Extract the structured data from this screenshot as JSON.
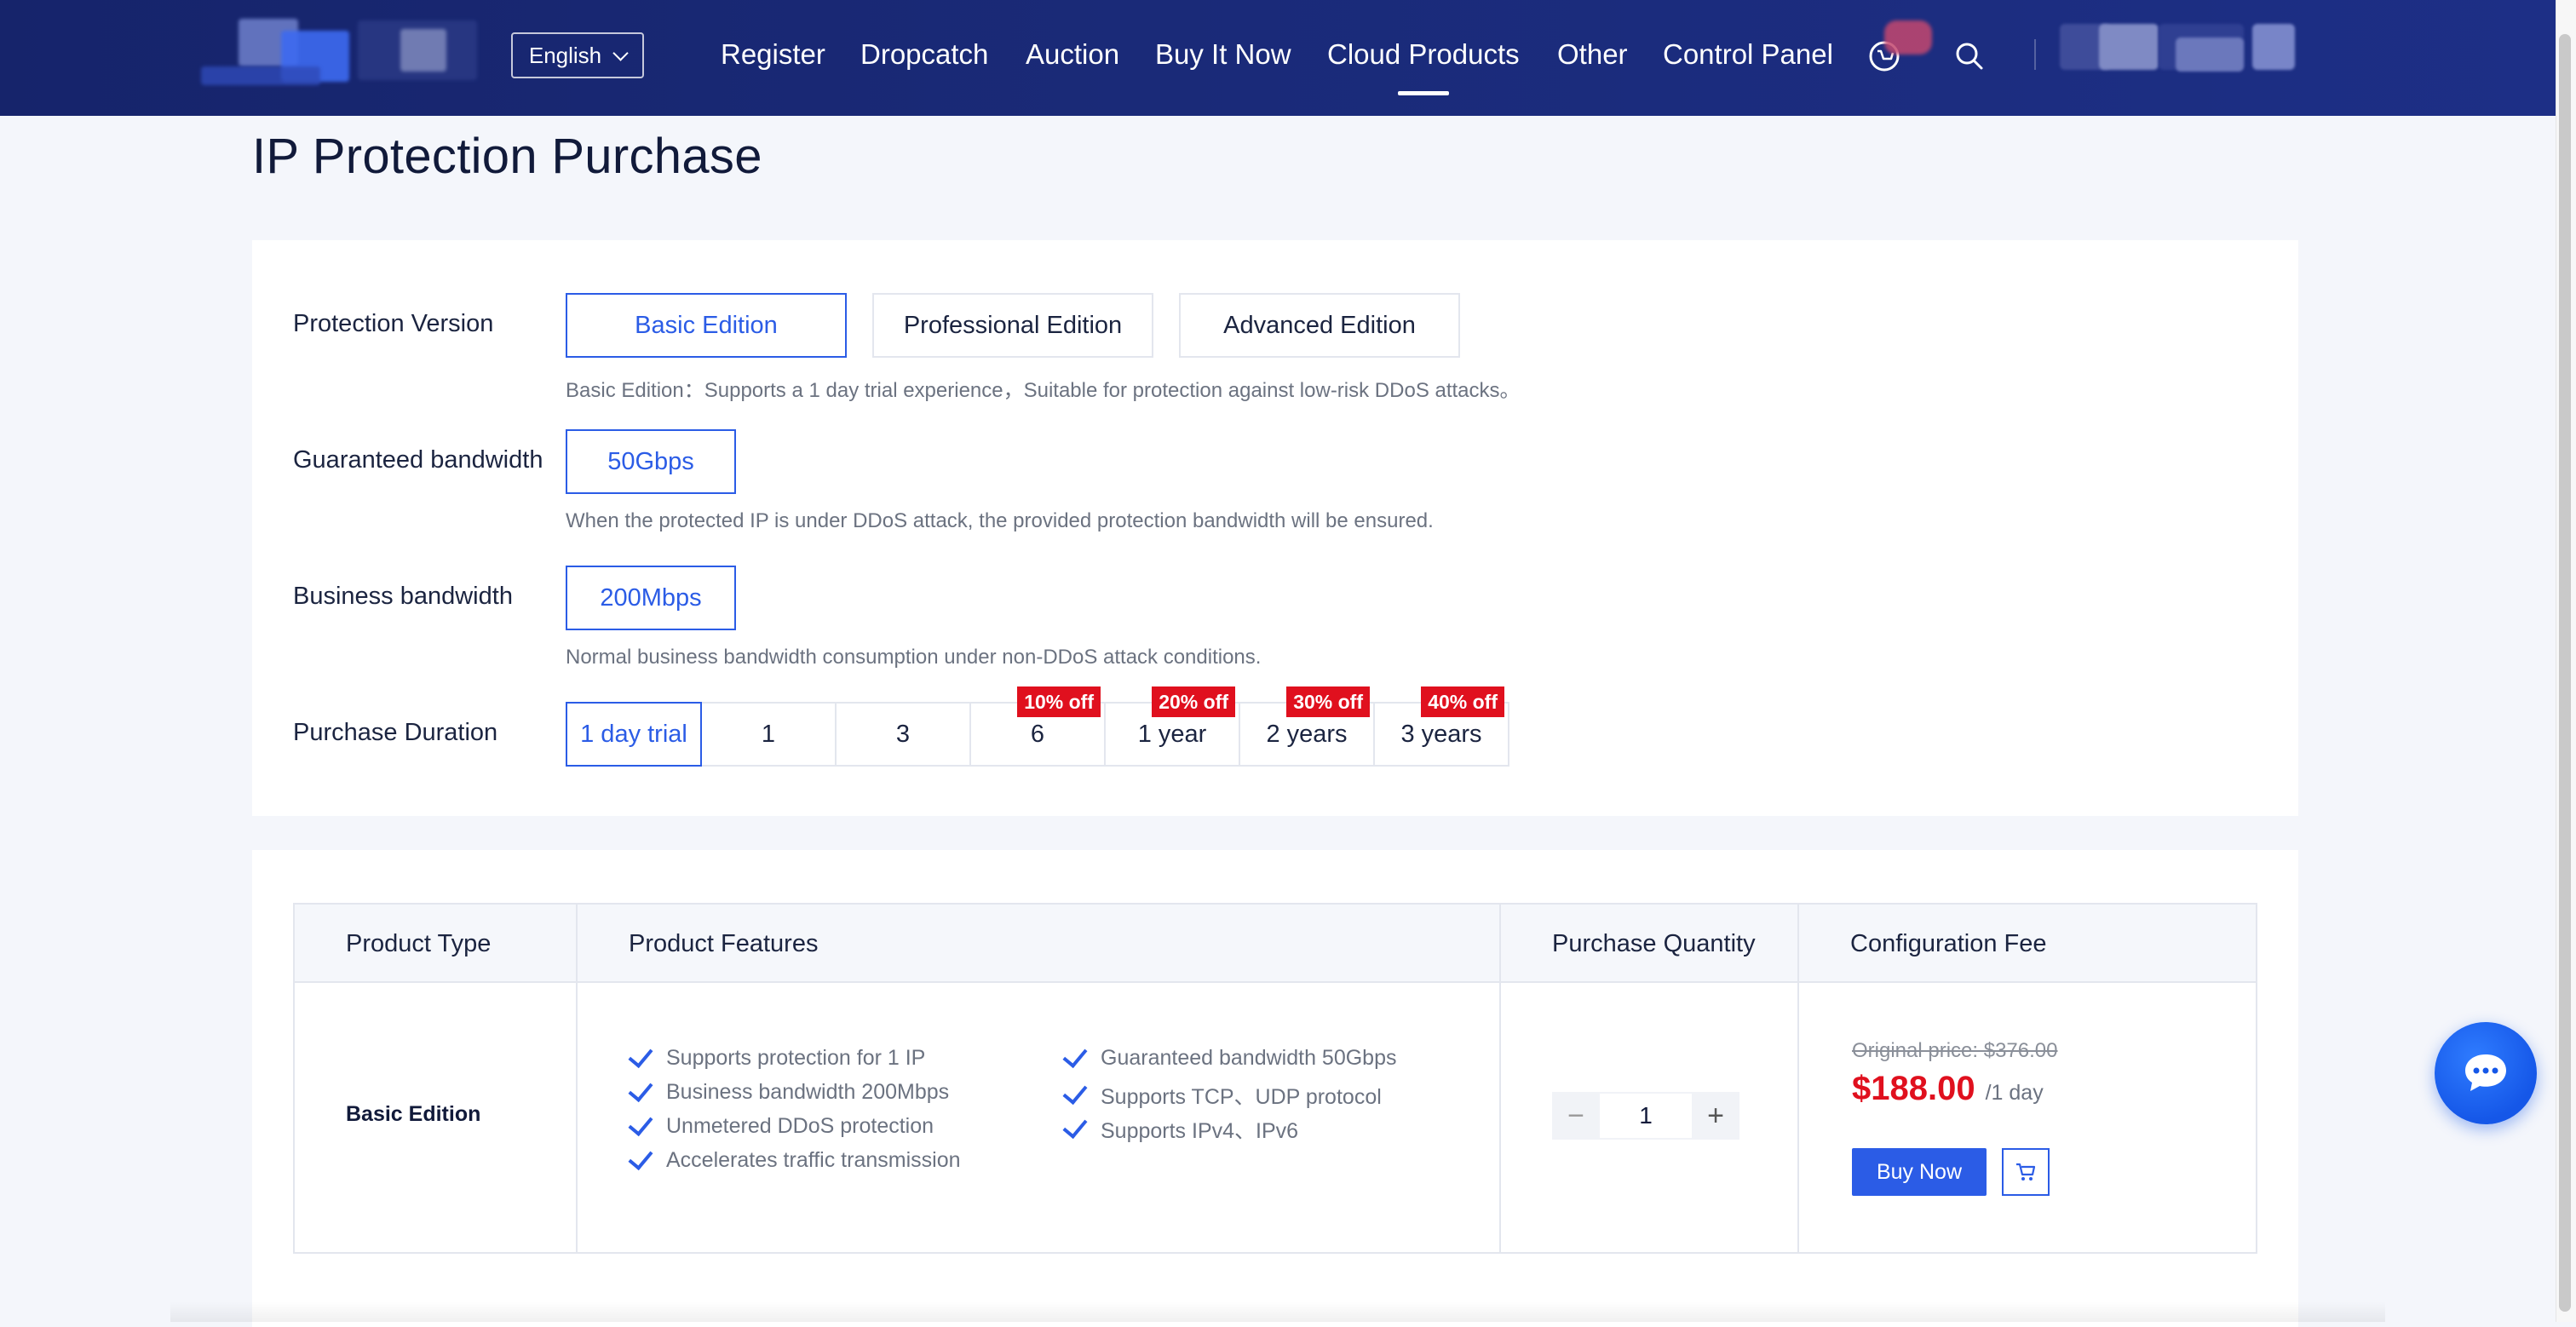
{
  "header": {
    "language": "English",
    "nav": [
      {
        "label": "Register"
      },
      {
        "label": "Dropcatch"
      },
      {
        "label": "Auction"
      },
      {
        "label": "Buy It Now"
      },
      {
        "label": "Cloud Products",
        "active": true
      },
      {
        "label": "Other"
      },
      {
        "label": "Control Panel"
      }
    ],
    "icons": [
      "cart-icon",
      "search-icon"
    ]
  },
  "page": {
    "title": "IP Protection Purchase"
  },
  "config": {
    "protection_version": {
      "label": "Protection Version",
      "options": [
        "Basic Edition",
        "Professional Edition",
        "Advanced Edition"
      ],
      "selected": "Basic Edition",
      "hint": "Basic Edition：Supports a 1 day trial experience，Suitable for protection against low-risk DDoS attacks。"
    },
    "guaranteed_bandwidth": {
      "label": "Guaranteed bandwidth",
      "options": [
        "50Gbps"
      ],
      "selected": "50Gbps",
      "hint": "When the protected IP is under DDoS attack, the provided protection bandwidth will be ensured."
    },
    "business_bandwidth": {
      "label": "Business bandwidth",
      "options": [
        "200Mbps"
      ],
      "selected": "200Mbps",
      "hint": "Normal business bandwidth consumption under non-DDoS attack conditions."
    },
    "purchase_duration": {
      "label": "Purchase Duration",
      "options": [
        {
          "label": "1 day trial",
          "badge": ""
        },
        {
          "label": "1",
          "badge": ""
        },
        {
          "label": "3",
          "badge": ""
        },
        {
          "label": "6",
          "badge": "10% off"
        },
        {
          "label": "1 year",
          "badge": "20% off"
        },
        {
          "label": "2 years",
          "badge": "30% off"
        },
        {
          "label": "3 years",
          "badge": "40% off"
        }
      ],
      "selected": "1 day trial"
    }
  },
  "summary": {
    "headers": [
      "Product Type",
      "Product Features",
      "Purchase Quantity",
      "Configuration Fee"
    ],
    "product_type": "Basic Edition",
    "features_left": [
      "Supports protection for 1 IP",
      "Business bandwidth 200Mbps",
      "Unmetered DDoS protection",
      "Accelerates traffic transmission"
    ],
    "features_right": [
      "Guaranteed bandwidth 50Gbps",
      "Supports TCP、UDP protocol",
      "Supports IPv4、IPv6"
    ],
    "quantity": "1",
    "stepper_minus": "−",
    "stepper_plus": "+",
    "original_price": "Original price: $376.00",
    "price": "$188.00",
    "per": "/1 day",
    "buy_label": "Buy Now"
  },
  "colors": {
    "accent": "#2b5ce6",
    "nav_bg": "#16246b",
    "discount_red": "#e0101e",
    "price_red": "#e0101e"
  }
}
